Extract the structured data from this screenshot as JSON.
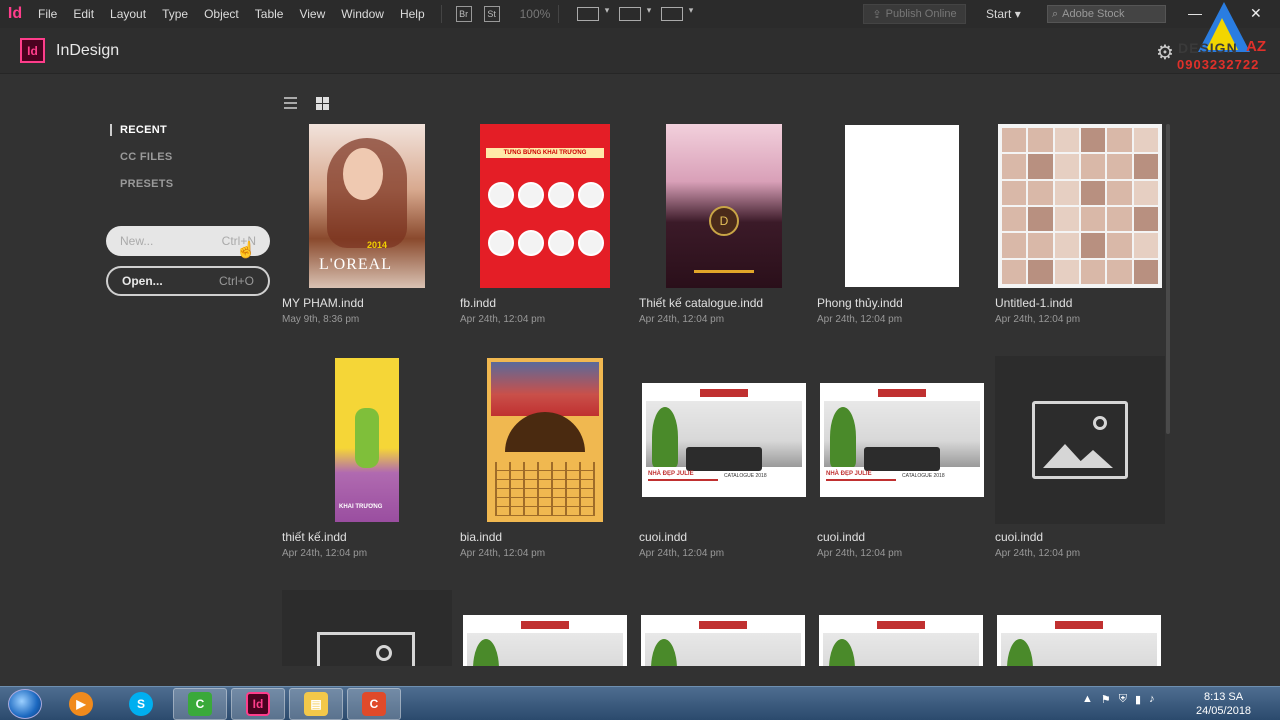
{
  "menubar": {
    "logo": "Id",
    "items": [
      "File",
      "Edit",
      "Layout",
      "Type",
      "Object",
      "Table",
      "View",
      "Window",
      "Help"
    ],
    "br_label": "Br",
    "st_label": "St",
    "zoom": "100%",
    "publish": "Publish Online",
    "workspace": "Start",
    "stock_placeholder": "Adobe Stock"
  },
  "header": {
    "logo": "Id",
    "title": "InDesign"
  },
  "brand": {
    "text": "DESIGN",
    "az": "AZ",
    "phone": "0903232722"
  },
  "nav": {
    "recent": "RECENT",
    "cc_files": "CC FILES",
    "presets": "PRESETS"
  },
  "actions": {
    "new_label": "New...",
    "new_shortcut": "Ctrl+N",
    "open_label": "Open...",
    "open_shortcut": "Ctrl+O"
  },
  "files": [
    {
      "name": "MY PHAM.indd",
      "date": "May 9th, 8:36 pm",
      "thumb_text": "L'OREAL",
      "thumb_year": "2014"
    },
    {
      "name": "fb.indd",
      "date": "Apr 24th, 12:04 pm",
      "thumb_text": "TƯNG BỪNG KHAI TRƯƠNG"
    },
    {
      "name": "Thiết kế catalogue.indd",
      "date": "Apr 24th, 12:04 pm",
      "thumb_text": "D"
    },
    {
      "name": "Phong thủy.indd",
      "date": "Apr 24th, 12:04 pm"
    },
    {
      "name": "Untitled-1.indd",
      "date": "Apr 24th, 12:04 pm"
    },
    {
      "name": "thiết kế.indd",
      "date": "Apr 24th, 12:04 pm",
      "thumb_text": "KHAI TRƯƠNG"
    },
    {
      "name": "bia.indd",
      "date": "Apr 24th, 12:04 pm"
    },
    {
      "name": "cuoi.indd",
      "date": "Apr 24th, 12:04 pm",
      "thumb_text": "NHÀ ĐẸP JULIE",
      "thumb_sub": "CATALOGUE 2018"
    },
    {
      "name": "cuoi.indd",
      "date": "Apr 24th, 12:04 pm",
      "thumb_text": "NHÀ ĐẸP JULIE",
      "thumb_sub": "CATALOGUE 2018"
    },
    {
      "name": "cuoi.indd",
      "date": "Apr 24th, 12:04 pm"
    }
  ],
  "taskbar": {
    "time": "8:13 SA",
    "date": "24/05/2018"
  }
}
